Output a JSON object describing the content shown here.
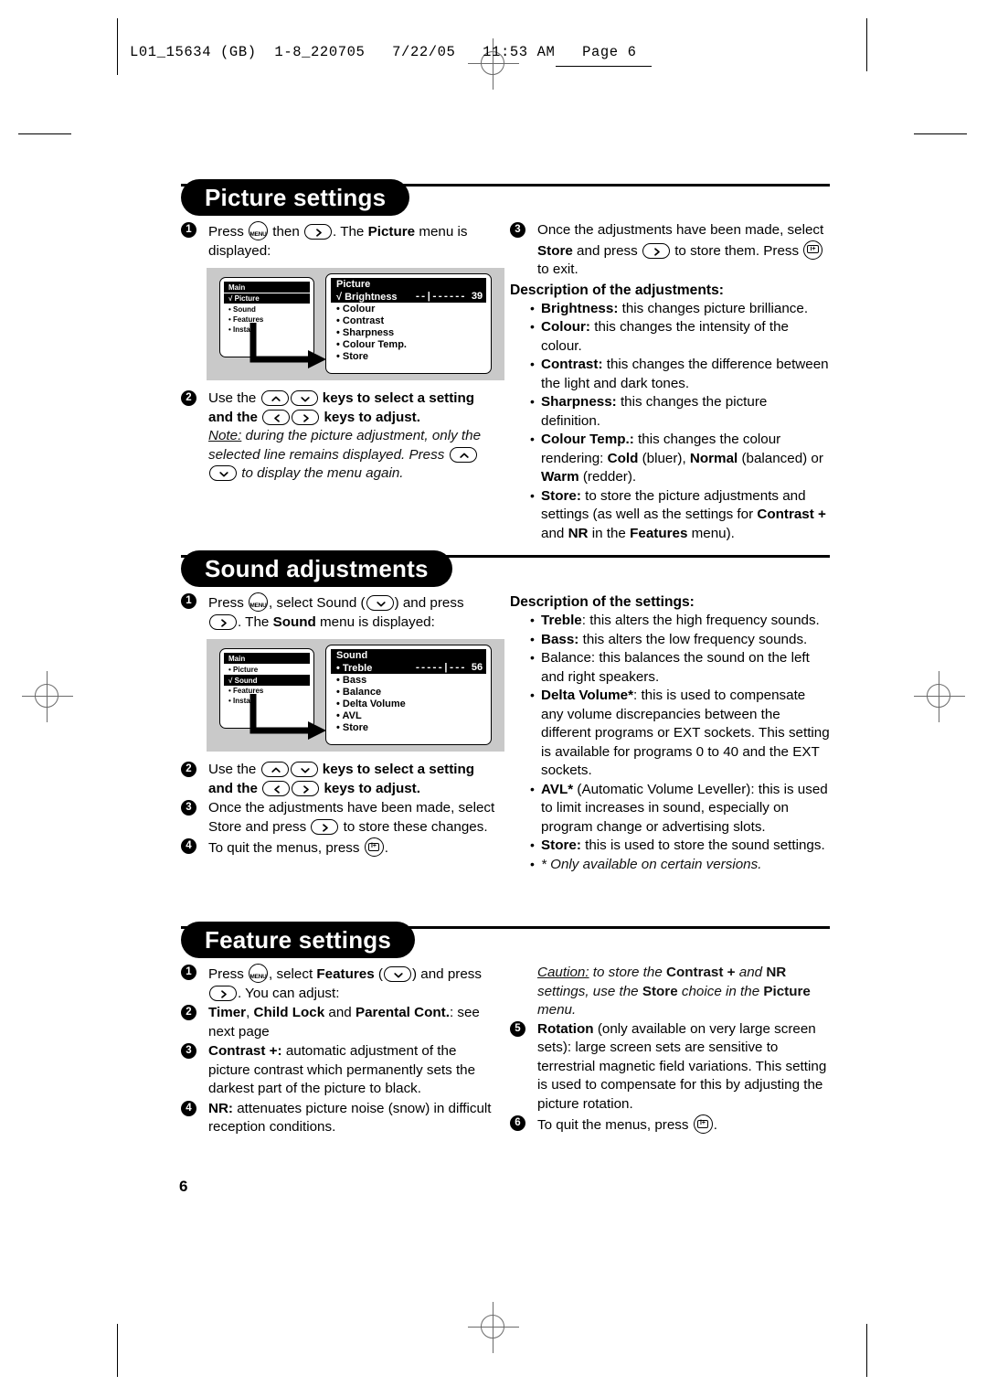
{
  "print_header": {
    "text": "L01_15634 (GB)  1-8_220705   7/22/05   11:53 AM   Page 6"
  },
  "page_number": "6",
  "icons": {
    "menu": "menu-button-icon",
    "right": "right-arrow-key-icon",
    "left": "left-arrow-key-icon",
    "up": "up-arrow-key-icon",
    "down": "down-arrow-key-icon",
    "exit": "exit-info-button-icon"
  },
  "sections": [
    {
      "id": "picture-settings",
      "title": "Picture settings",
      "left": {
        "step1": {
          "num": "1",
          "prefix": "Press ",
          "mid": " then ",
          "suffix": ". The ",
          "bold": "Picture",
          "tail": " menu is displayed:"
        },
        "step2": {
          "num": "2",
          "a": "Use the ",
          "b": " keys to select a setting and the ",
          "c": " keys to adjust.",
          "note_label": "Note:",
          "note_a": " during the picture adjustment, only the selected line remains displayed. Press ",
          "note_b": " to display the menu again."
        },
        "menu": {
          "main_title": "Main",
          "main_items": [
            "√ Picture",
            "• Sound",
            "• Features",
            "• Install"
          ],
          "main_selected_index": 0,
          "sub_title": "Picture",
          "sub_items": [
            {
              "label": "√ Brightness",
              "value": "--|------ 39",
              "selected": true
            },
            {
              "label": "• Colour",
              "value": "",
              "selected": false
            },
            {
              "label": "• Contrast",
              "value": "",
              "selected": false
            },
            {
              "label": "• Sharpness",
              "value": "",
              "selected": false
            },
            {
              "label": "• Colour Temp.",
              "value": "",
              "selected": false
            },
            {
              "label": "• Store",
              "value": "",
              "selected": false
            }
          ]
        }
      },
      "right": {
        "step3": {
          "num": "3",
          "a": "Once the adjustments have been made, select ",
          "store": "Store",
          "b": " and press ",
          "c": " to store them. Press ",
          "d": " to exit."
        },
        "desc_title": "Description of the adjustments:",
        "bullets": [
          {
            "term": "Brightness:",
            "text": " this changes picture brilliance."
          },
          {
            "term": "Colour:",
            "text": " this changes the intensity of the colour."
          },
          {
            "term": "Contrast:",
            "text": " this changes the difference between the light and dark tones."
          },
          {
            "term": "Sharpness:",
            "text": " this changes the picture definition."
          },
          {
            "term": "Colour Temp.:",
            "text": " this changes the colour rendering: ",
            "extra_bold_1": "Cold",
            "extra_1": " (bluer), ",
            "extra_bold_2": "Normal",
            "extra_2": " (balanced) or ",
            "extra_bold_3": "Warm",
            "extra_3": " (redder)."
          },
          {
            "term": "Store:",
            "text": " to store the picture adjustments and settings (as well as the settings for ",
            "extra_bold_1": "Contrast +",
            "extra_1": " and ",
            "extra_bold_2": "NR",
            "extra_2": " in the ",
            "extra_bold_3": "Features",
            "extra_3": " menu)."
          }
        ]
      }
    },
    {
      "id": "sound-adjustments",
      "title": "Sound adjustments",
      "left": {
        "step1": {
          "num": "1",
          "a": "Press ",
          "b": ", select Sound (",
          "c": ") and press ",
          "d": ". The ",
          "bold": "Sound",
          "e": " menu is displayed:"
        },
        "menu": {
          "main_title": "Main",
          "main_items": [
            "• Picture",
            "√ Sound",
            "• Features",
            "• Install"
          ],
          "main_selected_index": 1,
          "sub_title": "Sound",
          "sub_items": [
            {
              "label": "• Treble",
              "value": "-----|--- 56",
              "selected": true
            },
            {
              "label": "• Bass",
              "value": "",
              "selected": false
            },
            {
              "label": "• Balance",
              "value": "",
              "selected": false
            },
            {
              "label": "• Delta Volume",
              "value": "",
              "selected": false
            },
            {
              "label": "• AVL",
              "value": "",
              "selected": false
            },
            {
              "label": "• Store",
              "value": "",
              "selected": false
            }
          ]
        },
        "step2": {
          "num": "2",
          "a": "Use the ",
          "b": " keys to select a setting and the ",
          "c": " keys to adjust."
        },
        "step3": {
          "num": "3",
          "a": "Once the adjustments have been made, select Store and press ",
          "b": " to store these changes."
        },
        "step4": {
          "num": "4",
          "a": "To quit the menus, press ",
          "b": "."
        }
      },
      "right": {
        "desc_title": "Description of the settings:",
        "bullets": [
          {
            "term": "Treble",
            "text": ": this alters the high frequency sounds."
          },
          {
            "term": "Bass:",
            "text": " this alters the low frequency sounds."
          },
          {
            "term": "",
            "text": "Balance: this balances the sound on the left and right speakers."
          },
          {
            "term": "Delta Volume*",
            "text": ": this is used to compensate any volume discrepancies between the different programs or EXT sockets. This setting is available for programs 0 to 40 and the EXT sockets."
          },
          {
            "term": "AVL*",
            "text": " (Automatic Volume Leveller): this is used to limit increases in sound, especially on program change or advertising slots."
          },
          {
            "term": "Store:",
            "text": " this is used to store the sound settings."
          }
        ],
        "footnote": "* Only available on certain versions."
      }
    },
    {
      "id": "feature-settings",
      "title": "Feature settings",
      "left": {
        "step1": {
          "num": "1",
          "a": "Press ",
          "b": ", select ",
          "bold": "Features",
          "c": " (",
          "d": ") and press ",
          "e": ". You can adjust:"
        },
        "step2": {
          "num": "2",
          "bold1": "Timer",
          "a": ", ",
          "bold2": "Child Lock",
          "b": " and ",
          "bold3": "Parental Cont.",
          "c": ": see next page"
        },
        "step3": {
          "num": "3",
          "bold": "Contrast +:",
          "text": " automatic adjustment of the picture contrast which permanently sets the darkest part of the picture to black."
        },
        "step4": {
          "num": "4",
          "bold": "NR:",
          "text": " attenuates picture noise (snow) in difficult reception conditions."
        }
      },
      "right": {
        "caution": {
          "label": "Caution:",
          "a": " to store the ",
          "bold1": "Contrast +",
          "b": " and ",
          "bold2": "NR",
          "c": " settings, use the ",
          "bold3": "Store",
          "d": " choice in the ",
          "bold4": "Picture",
          "e": " menu."
        },
        "step5": {
          "num": "5",
          "bold": "Rotation",
          "text": " (only available on very large screen sets): large screen sets are sensitive to terrestrial magnetic field variations. This setting is used to compensate for this by adjusting the picture rotation."
        },
        "step6": {
          "num": "6",
          "a": "To quit the menus, press ",
          "b": "."
        }
      }
    }
  ]
}
